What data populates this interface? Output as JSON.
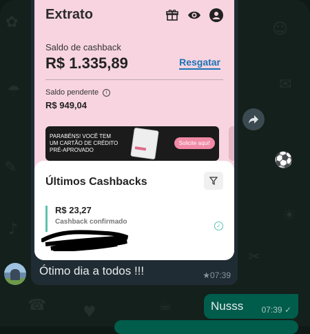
{
  "app": {
    "title": "Extrato",
    "icons": [
      "gift-icon",
      "eye-icon",
      "profile-icon"
    ]
  },
  "cashback": {
    "label": "Saldo de cashback",
    "amount": "R$ 1.335,89",
    "action": "Resgatar"
  },
  "pending": {
    "label": "Saldo pendente",
    "amount": "R$ 949,04"
  },
  "banner": {
    "line1": "PARABÉNS! VOCÊ TEM",
    "line2": "UM CARTÃO DE CRÉDITO",
    "line3": "PRÉ-APROVADO",
    "button": "Solicite aqui!"
  },
  "cashbacks_section": {
    "title": "Últimos Cashbacks",
    "items": [
      {
        "amount": "R$ 23,27",
        "status": "Cashback confirmado"
      }
    ]
  },
  "chat": {
    "incoming": {
      "text": "Ótimo dia a todos !!!",
      "time": "★07:39"
    },
    "outgoing": {
      "text": "Nusss",
      "time": "07:39 ✓"
    }
  },
  "colors": {
    "pink": "#f7d4e0",
    "accent_blue": "#1a73b5",
    "teal": "#5cc2b0",
    "bubble_in": "#202c33",
    "bubble_out": "#005c4b"
  }
}
